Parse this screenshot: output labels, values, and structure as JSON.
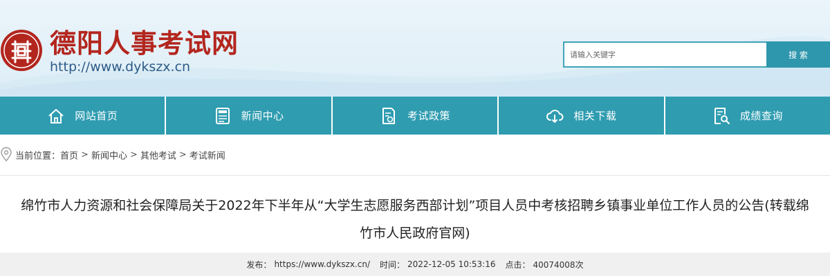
{
  "header": {
    "site_title": "德阳人事考试网",
    "site_url": "http://www.dykszx.cn",
    "logo_char": "德"
  },
  "search": {
    "placeholder": "请输入关键字",
    "button_label": "搜 索"
  },
  "nav": {
    "items": [
      {
        "label": "网站首页",
        "icon": "home-icon"
      },
      {
        "label": "新闻中心",
        "icon": "news-icon"
      },
      {
        "label": "考试政策",
        "icon": "policy-icon"
      },
      {
        "label": "相关下载",
        "icon": "cloud-download-icon"
      },
      {
        "label": "成绩查询",
        "icon": "search-document-icon"
      }
    ]
  },
  "breadcrumb": {
    "prefix": "当前位置：",
    "items": [
      "首页",
      "新闻中心",
      "其他考试",
      "考试新闻"
    ],
    "separator": ">"
  },
  "article": {
    "title_line1": "绵竹市人力资源和社会保障局关于2022年下半年从“大学生志愿服务西部计划”项目人员中考核招聘乡镇事业单位工作人员的公告(转载绵",
    "title_line2": "竹市人民政府官网)"
  },
  "meta": {
    "publisher_label": "发布：",
    "publisher": "https://www.dykszx.cn/",
    "time_label": "时间：",
    "time": "2022-12-05 10:53:16",
    "clicks_label": "点击：",
    "clicks": "40074008次"
  },
  "colors": {
    "nav_bg": "#2f9cb0",
    "title_red": "#b3261e",
    "search_border": "#3fa3b8"
  }
}
